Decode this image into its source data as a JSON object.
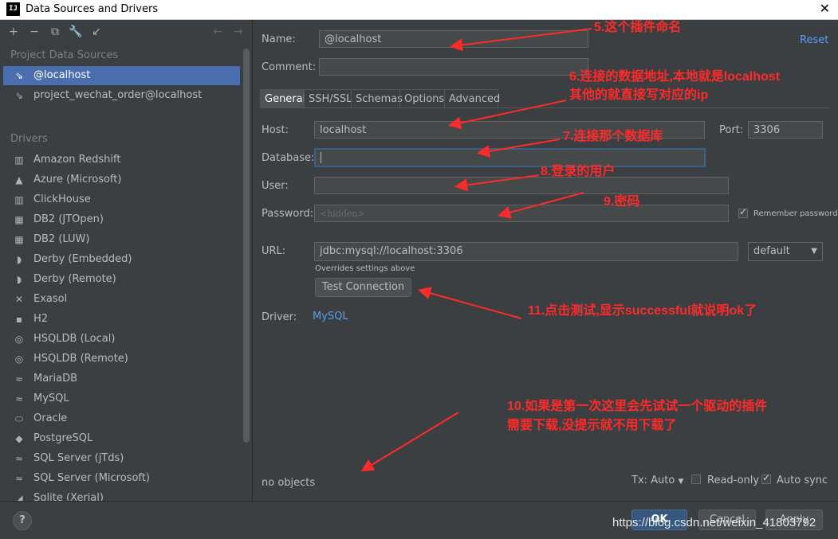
{
  "window": {
    "title": "Data Sources and Drivers",
    "app_icon": "IJ"
  },
  "left": {
    "project_header": "Project Data Sources",
    "project_items": [
      {
        "label": "@localhost",
        "icon": "datasource-icon",
        "selected": true
      },
      {
        "label": "project_wechat_order@localhost",
        "icon": "datasource-icon",
        "selected": false
      }
    ],
    "drivers_header": "Drivers",
    "drivers": [
      {
        "label": "Amazon Redshift",
        "icon": "redshift-icon"
      },
      {
        "label": "Azure (Microsoft)",
        "icon": "azure-icon"
      },
      {
        "label": "ClickHouse",
        "icon": "clickhouse-icon"
      },
      {
        "label": "DB2 (JTOpen)",
        "icon": "db2-icon"
      },
      {
        "label": "DB2 (LUW)",
        "icon": "db2-icon"
      },
      {
        "label": "Derby (Embedded)",
        "icon": "derby-icon"
      },
      {
        "label": "Derby (Remote)",
        "icon": "derby-icon"
      },
      {
        "label": "Exasol",
        "icon": "exasol-icon"
      },
      {
        "label": "H2",
        "icon": "h2-icon"
      },
      {
        "label": "HSQLDB (Local)",
        "icon": "hsqldb-icon"
      },
      {
        "label": "HSQLDB (Remote)",
        "icon": "hsqldb-icon"
      },
      {
        "label": "MariaDB",
        "icon": "mariadb-icon"
      },
      {
        "label": "MySQL",
        "icon": "mysql-icon"
      },
      {
        "label": "Oracle",
        "icon": "oracle-icon"
      },
      {
        "label": "PostgreSQL",
        "icon": "postgresql-icon"
      },
      {
        "label": "SQL Server (jTds)",
        "icon": "sqlserver-icon"
      },
      {
        "label": "SQL Server (Microsoft)",
        "icon": "sqlserver-icon"
      },
      {
        "label": "Sqlite (Xerial)",
        "icon": "sqlite-icon"
      }
    ]
  },
  "form": {
    "name_label": "Name:",
    "name_value": "@localhost",
    "reset_label": "Reset",
    "comment_label": "Comment:",
    "tabs": [
      "General",
      "SSH/SSL",
      "Schemas",
      "Options",
      "Advanced"
    ],
    "host_label": "Host:",
    "host_value": "localhost",
    "port_label": "Port:",
    "port_value": "3306",
    "database_label": "Database:",
    "user_label": "User:",
    "password_label": "Password:",
    "password_placeholder": "<hidden>",
    "remember_password_label": "Remember password",
    "url_label": "URL:",
    "url_value": "jdbc:mysql://localhost:3306",
    "url_mode": "default",
    "overrides_note": "Overrides settings above",
    "test_connection_label": "Test Connection",
    "driver_label": "Driver:",
    "driver_value": "MySQL",
    "no_objects": "no objects",
    "tx_label": "Tx: Auto",
    "read_only_label": "Read-only",
    "auto_sync_label": "Auto sync"
  },
  "footer": {
    "help_label": "?",
    "ok_label": "OK",
    "cancel_label": "Cancel",
    "apply_label": "Apply",
    "watermark": "https://blog.csdn.net/weixin_41803792"
  },
  "annotations": {
    "n5": "5.这个插件命名",
    "n6_line1": "6.连接的数据地址,本地就是localhost",
    "n6_line2": "其他的就直接写对应的ip",
    "n7": "7.连接那个数据库",
    "n8": "8.登录的用户",
    "n9": "9.密码",
    "n11": "11.点击测试,显示successful就说明ok了",
    "n10_line1": "10.如果是第一次这里会先试试一个驱动的插件",
    "n10_line2": "需要下载,没提示就不用下载了"
  },
  "colors": {
    "background": "#3c3f41",
    "selection": "#4b6eaf",
    "link": "#589df6",
    "annotation": "#ff2a2a",
    "ok_button": "#365880"
  }
}
